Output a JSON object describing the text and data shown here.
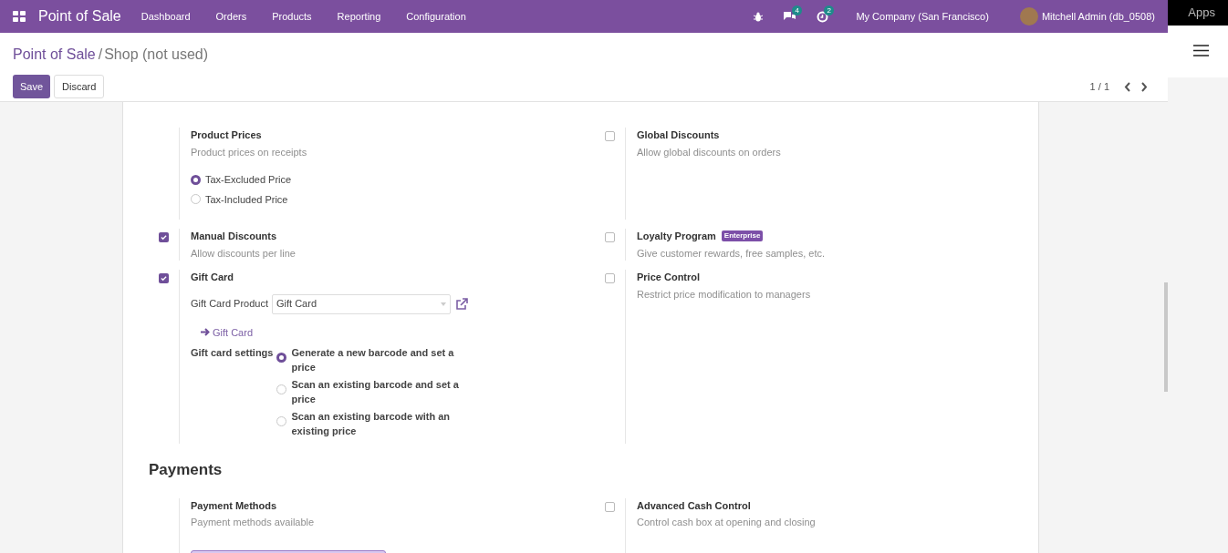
{
  "navbar": {
    "app_title": "Point of Sale",
    "menu": [
      "Dashboard",
      "Orders",
      "Products",
      "Reporting",
      "Configuration"
    ],
    "messages_badge": "4",
    "activities_badge": "2",
    "company": "My Company (San Francisco)",
    "user": "Mitchell Admin (db_0508)"
  },
  "apps_bar": {
    "label": "Apps"
  },
  "breadcrumb": {
    "parent": "Point of Sale",
    "separator": "/",
    "current": "Shop (not used)"
  },
  "buttons": [
    {
      "label": "Save",
      "kind": "primary"
    },
    {
      "label": "Discard",
      "kind": "secondary"
    }
  ],
  "pager": "1 / 1",
  "sections": [
    {
      "rows": [
        {
          "left": {
            "kind": "options",
            "title": "Product Prices",
            "description": "Product prices on receipts",
            "options": [
              {
                "label": "Tax-Excluded Price",
                "selected": true
              },
              {
                "label": "Tax-Included Price",
                "selected": false
              }
            ]
          },
          "right": {
            "kind": "toggle",
            "checked": false,
            "title": "Global Discounts",
            "description": "Allow global discounts on orders"
          }
        },
        {
          "left": {
            "kind": "toggle",
            "checked": true,
            "title": "Manual Discounts",
            "description": "Allow discounts per line"
          },
          "right": {
            "kind": "toggle",
            "checked": false,
            "title": "Loyalty Program",
            "badge": "Enterprise",
            "description": "Give customer rewards, free samples, etc."
          }
        },
        {
          "left": {
            "kind": "toggle",
            "checked": true,
            "title": "Gift Card",
            "gift_card": {
              "product_label": "Gift Card Product",
              "product_value": "Gift Card",
              "link": "Gift Card",
              "settings_label": "Gift card settings",
              "choices": [
                {
                  "label": "Generate a new barcode and set a price",
                  "selected": true
                },
                {
                  "label": "Scan an existing barcode and set a price",
                  "selected": false
                },
                {
                  "label": "Scan an existing barcode with an existing price",
                  "selected": false
                }
              ]
            }
          },
          "right": {
            "kind": "toggle",
            "checked": false,
            "title": "Price Control",
            "description": "Restrict price modification to managers"
          }
        }
      ]
    },
    {
      "title": "Payments",
      "rows": [
        {
          "left": {
            "kind": "field",
            "title": "Payment Methods",
            "description": "Payment methods available"
          },
          "right": {
            "kind": "toggle",
            "checked": false,
            "title": "Advanced Cash Control",
            "description": "Control cash box at opening and closing"
          }
        }
      ]
    }
  ]
}
